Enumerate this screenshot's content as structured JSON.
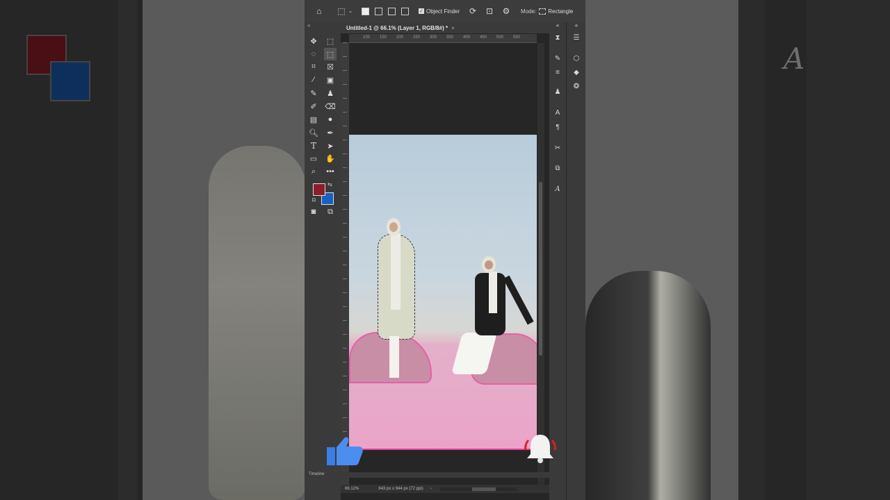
{
  "options_bar": {
    "object_finder_label": "Object Finder",
    "mode_label": "Mode:",
    "mode_value": "Rectangle"
  },
  "document": {
    "tab_title": "Untitled-1 @ 66.1% (Layer 1, RGB/8#) *",
    "tab_close": "×",
    "ruler_ticks": [
      "100",
      "150",
      "200",
      "250",
      "300",
      "350",
      "400",
      "450",
      "500",
      "550"
    ],
    "zoom": "66.12%",
    "dimensions": "643 px x 944 px (72 ppi)",
    "timeline_label": "Timeline"
  },
  "colors": {
    "foreground": "#8b1e2a",
    "background": "#1c5fc2",
    "selection_overlay": "#e560a8"
  },
  "icons": {
    "like": "thumbs-up-icon",
    "bell": "notification-bell-icon"
  }
}
